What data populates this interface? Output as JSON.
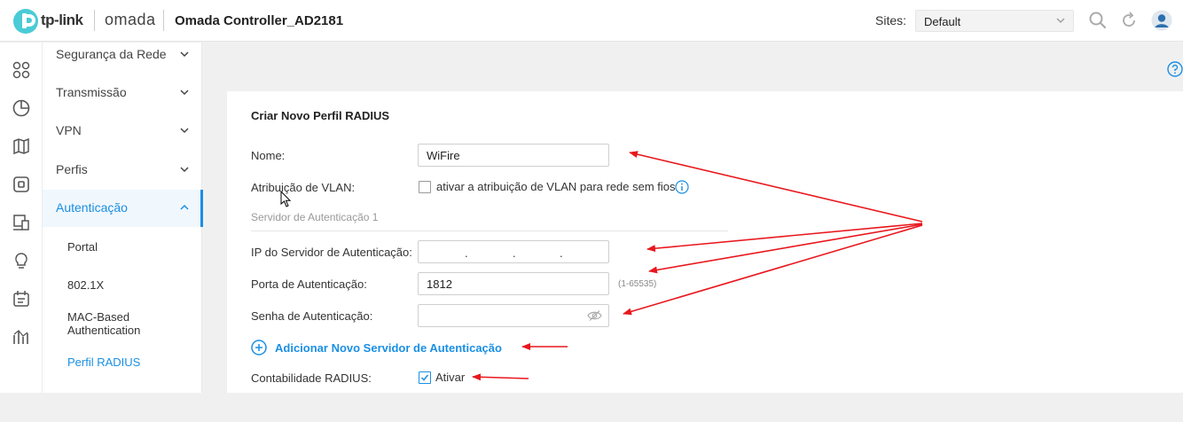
{
  "header": {
    "brand_tplink": "tp-link",
    "brand_omada": "omada",
    "app_title": "Omada Controller_AD2181",
    "sites_label": "Sites:",
    "sites_value": "Default"
  },
  "rail": {
    "icons": [
      "dashboard-icon",
      "statistics-icon",
      "map-icon",
      "devices-icon",
      "clients-icon",
      "insight-icon",
      "log-icon",
      "report-icon"
    ]
  },
  "sidebar": {
    "items": [
      {
        "label": "Segurança da Rede"
      },
      {
        "label": "Transmissão"
      },
      {
        "label": "VPN"
      },
      {
        "label": "Perfis"
      },
      {
        "label": "Autenticação"
      }
    ],
    "sub_items": [
      {
        "label": "Portal"
      },
      {
        "label": "802.1X"
      },
      {
        "label": "MAC-Based\nAuthentication"
      },
      {
        "label": "Perfil RADIUS"
      }
    ]
  },
  "form": {
    "title": "Criar Novo Perfil RADIUS",
    "name_label": "Nome:",
    "name_value": "WiFire",
    "vlan_label": "Atribuição de VLAN:",
    "vlan_checkbox_text": "ativar a atribuição de VLAN para rede sem fios",
    "vlan_checked": false,
    "server_section": "Servidor de Autenticação 1",
    "ip_label": "IP do Servidor de Autenticação:",
    "ip_dots": [
      ".",
      ".",
      "."
    ],
    "port_label": "Porta de Autenticação:",
    "port_value": "1812",
    "port_hint": "(1-65535)",
    "password_label": "Senha de Autenticação:",
    "password_value": "",
    "add_server_label": "Adicionar Novo Servidor de Autenticação",
    "accounting_label": "Contabilidade RADIUS:",
    "accounting_checkbox_text": "Ativar",
    "accounting_checked": true
  },
  "colors": {
    "accent": "#1a8fe3",
    "annotation_arrow": "#e8171d",
    "page_background": "#f0f0f1"
  }
}
